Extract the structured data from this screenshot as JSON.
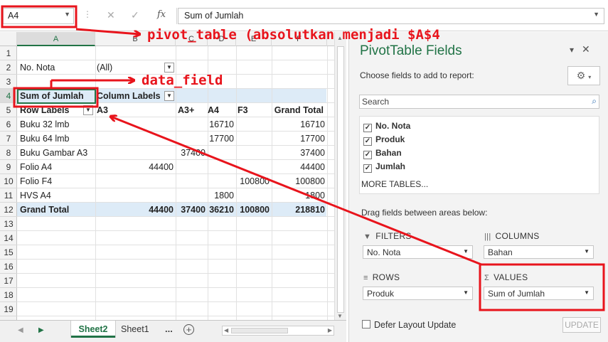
{
  "formula_bar": {
    "name_box": "A4",
    "cancel_icon": "✕",
    "enter_icon": "✓",
    "fx_label": "fx",
    "content": "Sum of Jumlah"
  },
  "columns": [
    "A",
    "B",
    "C",
    "D",
    "E",
    "F"
  ],
  "rows": [
    "1",
    "2",
    "3",
    "4",
    "5",
    "6",
    "7",
    "8",
    "9",
    "10",
    "11",
    "12",
    "13",
    "14",
    "15",
    "16",
    "17",
    "18",
    "19"
  ],
  "pivot": {
    "filter_label": "No. Nota",
    "filter_value": "(All)",
    "value_label": "Sum of Jumlah",
    "column_labels": "Column Labels",
    "row_labels": "Row Labels",
    "headers": [
      "A3",
      "A3+",
      "A4",
      "F3",
      "Grand Total"
    ],
    "body": [
      {
        "label": "Buku 32 lmb",
        "values": [
          "",
          "",
          "16710",
          "",
          "16710"
        ]
      },
      {
        "label": "Buku 64 lmb",
        "values": [
          "",
          "",
          "17700",
          "",
          "17700"
        ]
      },
      {
        "label": "Buku Gambar A3",
        "values": [
          "",
          "37400",
          "",
          "",
          "37400"
        ]
      },
      {
        "label": "Folio A4",
        "values": [
          "44400",
          "",
          "",
          "",
          "44400"
        ]
      },
      {
        "label": "Folio F4",
        "values": [
          "",
          "",
          "",
          "100800",
          "100800"
        ]
      },
      {
        "label": "HVS A4",
        "values": [
          "",
          "",
          "1800",
          "",
          "1800"
        ]
      }
    ],
    "grand_total": {
      "label": "Grand Total",
      "values": [
        "44400",
        "37400",
        "36210",
        "100800",
        "218810"
      ]
    }
  },
  "sheet_tabs": {
    "active": "Sheet2",
    "other": "Sheet1",
    "more": "...",
    "add": "+"
  },
  "pivot_pane": {
    "title": "PivotTable Fields",
    "choose_text": "Choose fields to add to report:",
    "search_placeholder": "Search",
    "fields": [
      "No. Nota",
      "Produk",
      "Bahan",
      "Jumlah"
    ],
    "more_tables": "MORE TABLES...",
    "drag_text": "Drag fields between areas below:",
    "filters": {
      "header": "FILTERS",
      "value": "No. Nota"
    },
    "columns": {
      "header": "COLUMNS",
      "value": "Bahan"
    },
    "rows": {
      "header": "ROWS",
      "value": "Produk"
    },
    "values": {
      "header": "VALUES",
      "value": "Sum of Jumlah"
    },
    "defer_label": "Defer Layout Update",
    "update_label": "UPDATE"
  },
  "annotations": {
    "pivot_table_note": "pivot_table (absolutkan menjadi $A$4",
    "data_field_note": "data_field",
    "color": "#e8141c"
  },
  "colors": {
    "excel_green": "#217346",
    "pivot_band": "#ddebf7"
  }
}
